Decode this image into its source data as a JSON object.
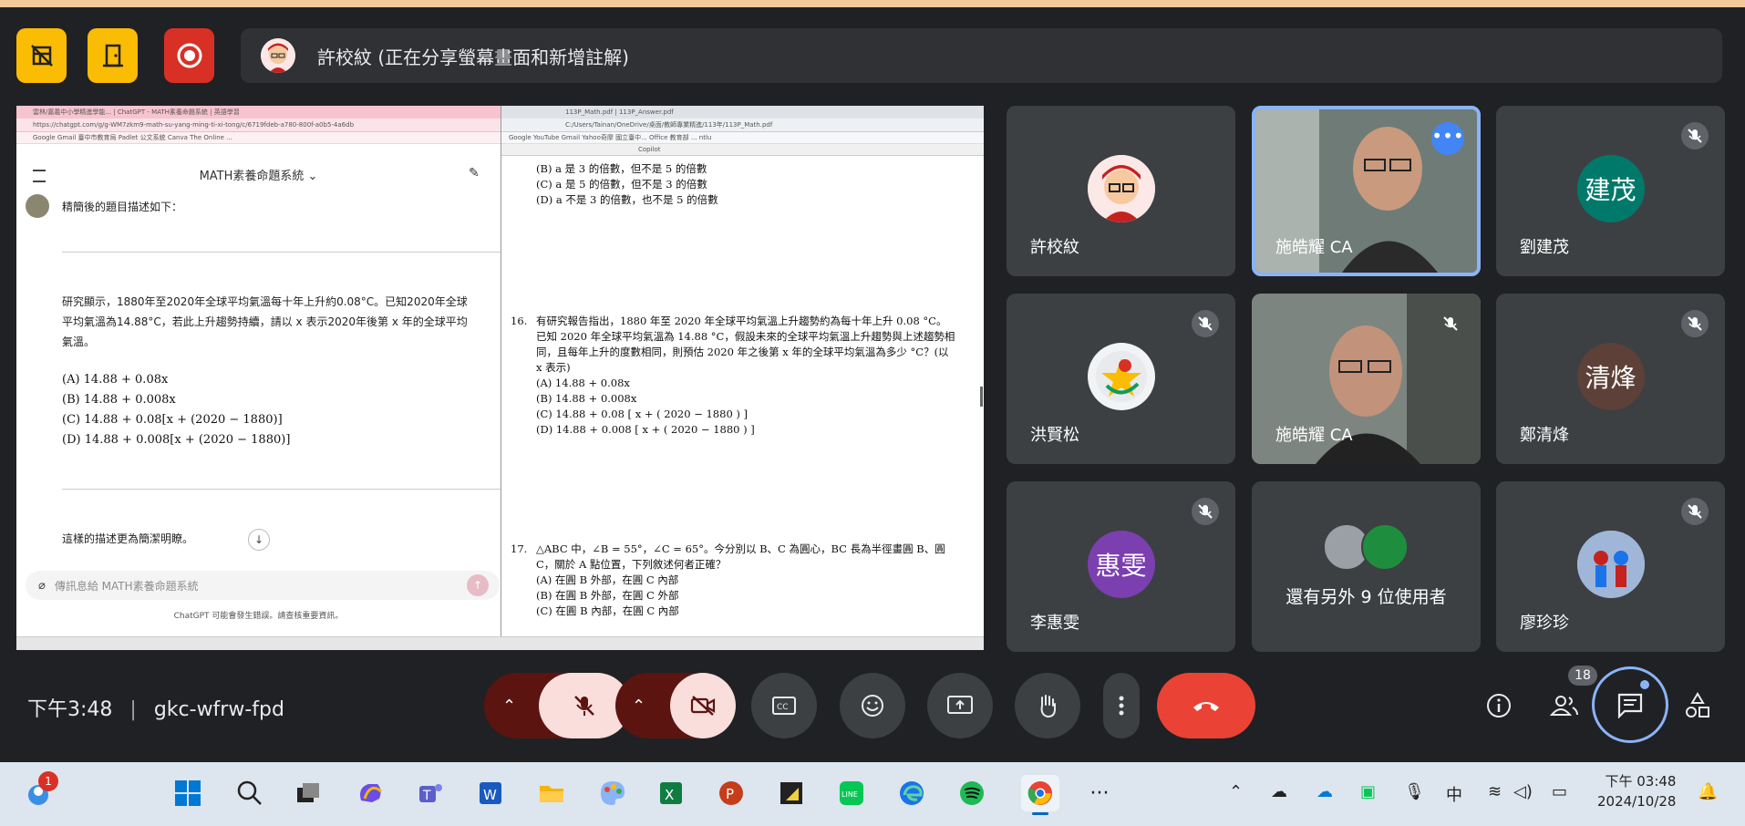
{
  "banner": {
    "text": "許校紋 (正在分享螢幕畫面和新增註解)"
  },
  "toolbar_icons": [
    "layout-off-icon",
    "door-icon",
    "record-icon"
  ],
  "share": {
    "chatgpt": {
      "tabs": "雲林/嘉義中小學精進學能... | ChatGPT - MATH素養命題系統 | 英語學習",
      "url": "https://chatgpt.com/g/g-WM7zkm9-math-su-yang-ming-ti-xi-tong/c/6719fdeb-a780-800f-a0b5-4a6db",
      "bookmarks": "Google  Gmail  臺中市教育局  Padlet  公文系統  Canva  The Online ...",
      "title": "MATH素養命題系統 ⌄",
      "intro": "精簡後的題目描述如下：",
      "paragraph": "研究顯示，1880年至2020年全球平均氣溫每十年上升約0.08°C。已知2020年全球平均氣溫為14.88°C，若此上升趨勢持續，請以 x 表示2020年後第 x 年的全球平均氣溫。",
      "options": [
        "(A) 14.88 + 0.08x",
        "(B) 14.88 + 0.008x",
        "(C) 14.88 + 0.08[x + (2020 − 1880)]",
        "(D) 14.88 + 0.008[x + (2020 − 1880)]"
      ],
      "footer": "這樣的描述更為簡潔明瞭。",
      "input_placeholder": "傳訊息給 MATH素養命題系統",
      "note": "ChatGPT 可能會發生錯誤。請查核重要資訊。"
    },
    "pdf": {
      "tabs": "113P_Math.pdf | 113P_Answer.pdf",
      "url": "C:/Users/Tainan/OneDrive/桌面/教師專業精進/113年/113P_Math.pdf",
      "bookmarks": "Google  YouTube  Gmail  Yahoo奇摩  國立臺中...  Office  教育部  ...  ntlu",
      "tool": "Copilot",
      "prev_options": [
        "(B) a 是 3 的倍數，但不是 5 的倍數",
        "(C) a 是 5 的倍數，但不是 3 的倍數",
        "(D) a 不是 3 的倍數，也不是 5 的倍數"
      ],
      "q16_num": "16.",
      "q16_text": "有研究報告指出，1880 年至 2020 年全球平均氣溫上升趨勢約為每十年上升 0.08 °C。已知 2020 年全球平均氣溫為 14.88 °C，假設未來的全球平均氣溫上升趨勢與上述趨勢相同，且每年上升的度數相同，則預估 2020 年之後第 x 年的全球平均氣溫為多少 °C？(以 x 表示)",
      "q16_options": [
        "(A) 14.88 + 0.08x",
        "(B) 14.88 + 0.008x",
        "(C) 14.88 + 0.08 [ x + ( 2020 − 1880 ) ]",
        "(D) 14.88 + 0.008 [ x + ( 2020 − 1880 ) ]"
      ],
      "q17_num": "17.",
      "q17_text": "△ABC 中，∠B = 55°，∠C = 65°。今分別以 B、C 為圓心，BC 長為半徑畫圓 B、圓 C，關於 A 點位置，下列敘述何者正確？",
      "q17_options": [
        "(A) 在圓 B 外部，在圓 C 內部",
        "(B) 在圓 B 外部，在圓 C 外部",
        "(C) 在圓 B 內部，在圓 C 內部"
      ]
    }
  },
  "participants": [
    {
      "name": "許校紋",
      "type": "avatar"
    },
    {
      "name": "施皓耀 CA",
      "type": "video"
    },
    {
      "name": "劉建茂",
      "initials": "建茂",
      "color": "#00796b"
    },
    {
      "name": "洪賢松",
      "type": "logo"
    },
    {
      "name": "施皓耀 CA",
      "type": "video"
    },
    {
      "name": "鄭清烽",
      "initials": "清烽",
      "color": "#5d4037"
    },
    {
      "name": "李惠雯",
      "initials": "惠雯",
      "color": "#7b3fb0"
    },
    {
      "name": "還有另外 9 位使用者",
      "type": "more"
    },
    {
      "name": "廖珍珍",
      "type": "photo"
    }
  ],
  "meeting": {
    "time": "下午3:48",
    "code": "gkc-wfrw-fpd",
    "people_count": "18"
  },
  "taskbar": {
    "notification_badge": "1",
    "ime": "中",
    "clock_time": "下午 03:48",
    "clock_date": "2024/10/28"
  }
}
